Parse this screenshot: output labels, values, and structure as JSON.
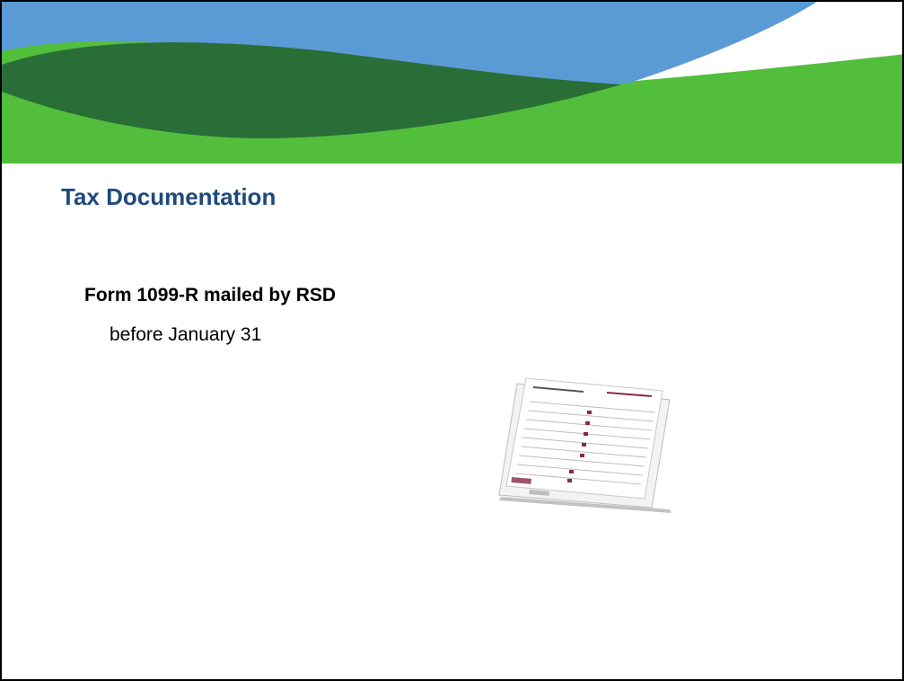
{
  "slide": {
    "title": "Tax Documentation",
    "heading": "Form 1099-R mailed by RSD",
    "subtext": "before January 31"
  },
  "colors": {
    "title_text": "#1f497d",
    "banner_blue": "#5b9bd5",
    "banner_dark_green": "#2a6e37",
    "banner_light_green": "#52be3c"
  },
  "images": {
    "banner": "wave-banner-graphic",
    "forms": "stacked-tax-forms-illustration"
  }
}
